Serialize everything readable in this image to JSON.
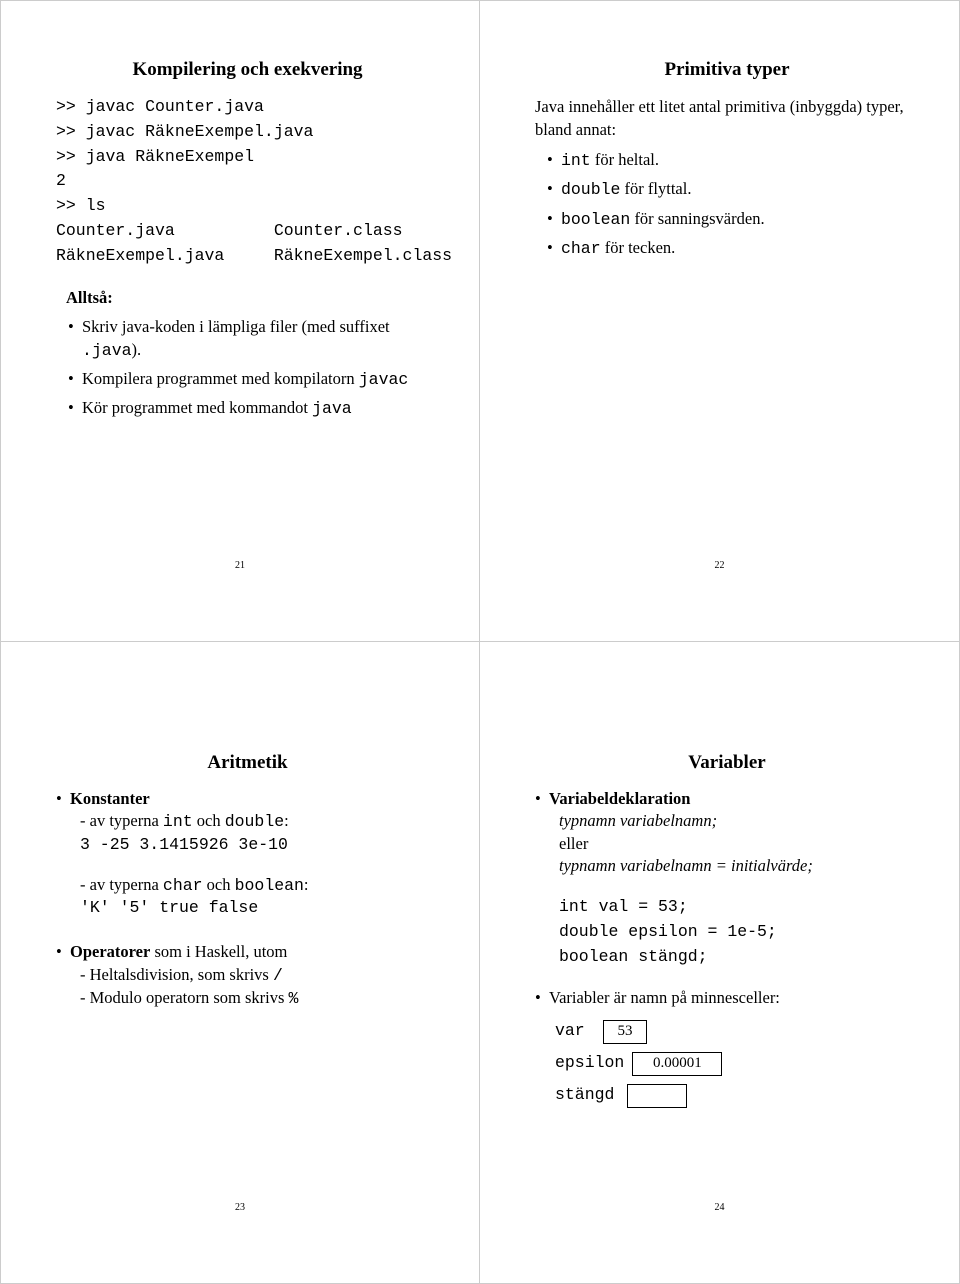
{
  "slide21": {
    "title": "Kompilering och exekvering",
    "terminal": ">> javac Counter.java\n>> javac RäkneExempel.java\n>> java RäkneExempel\n2\n>> ls\nCounter.java          Counter.class\nRäkneExempel.java     RäkneExempel.class",
    "subhead": "Alltså:",
    "b1_a": "Skriv java-koden i lämpliga filer (med suffixet ",
    "b1_code": ".java",
    "b1_b": ").",
    "b2_a": "Kompilera programmet med kompilatorn ",
    "b2_code": "javac",
    "b3_a": "Kör programmet med kommandot ",
    "b3_code": "java",
    "page": "21"
  },
  "slide22": {
    "title": "Primitiva typer",
    "intro": "Java innehåller ett litet antal primitiva (inbyggda) typer, bland annat:",
    "b1_code": "int",
    "b1_txt": " för heltal.",
    "b2_code": "double",
    "b2_txt": " för flyttal.",
    "b3_code": "boolean",
    "b3_txt": " för sanningsvärden.",
    "b4_code": "char",
    "b4_txt": " för tecken.",
    "page": "22"
  },
  "slide23": {
    "title": "Aritmetik",
    "h1": "Konstanter",
    "l1a": "- av typerna ",
    "l1_int": "int",
    "l1_och": " och ",
    "l1_dbl": "double",
    "l1_colon": ":",
    "consts1": "3   -25   3.1415926   3e-10",
    "l2a": "- av typerna ",
    "l2_char": "char",
    "l2_och": " och ",
    "l2_bool": "boolean",
    "l2_colon": ":",
    "consts2": "'K'   '5'   true   false",
    "h2a": "Operatorer",
    "h2b": " som i Haskell, utom",
    "op1a": "- Heltalsdivision, som skrivs ",
    "op1b": "/",
    "op2a": "- Modulo operatorn som skrivs ",
    "op2b": "%",
    "page": "23"
  },
  "slide24": {
    "title": "Variabler",
    "h1": "Variabeldeklaration",
    "syntax1": "typnamn variabelnamn;",
    "eller": "eller",
    "syntax2": "typnamn variabelnamn = initialvärde;",
    "code": "int val = 53;\ndouble epsilon = 1e-5;\nboolean stängd;",
    "b2": "Variabler är namn på minnesceller:",
    "mem1_name": "var",
    "mem1_val": "53",
    "mem2_name": "epsilon",
    "mem2_val": "0.00001",
    "mem3_name": "stängd",
    "mem3_val": "",
    "page": "24"
  }
}
